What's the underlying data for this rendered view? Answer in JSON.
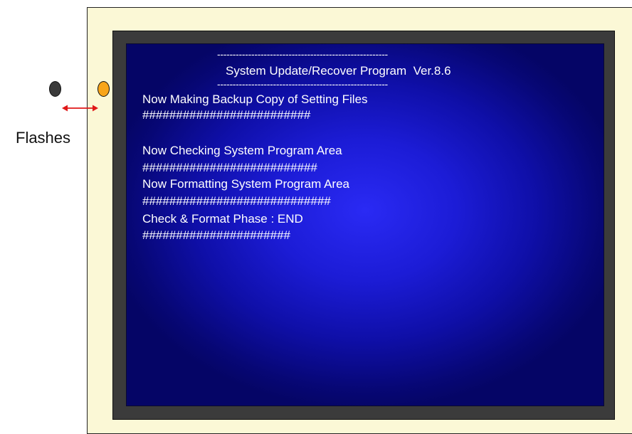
{
  "screen": {
    "rule": "-------------------------------------------------------",
    "title": "System Update/Recover Program  Ver.8.6",
    "lines": [
      "Now Making Backup Copy of Setting Files",
      "#########################",
      "",
      "Now Checking System Program Area",
      "##########################",
      "Now Formatting System Program Area",
      "############################",
      "Check & Format Phase : END",
      "######################"
    ]
  },
  "indicators": {
    "label": "Flashes",
    "left_led_color": "#3a3a3a",
    "right_led_color": "#f8a51a",
    "arrow_color": "#e01818"
  }
}
